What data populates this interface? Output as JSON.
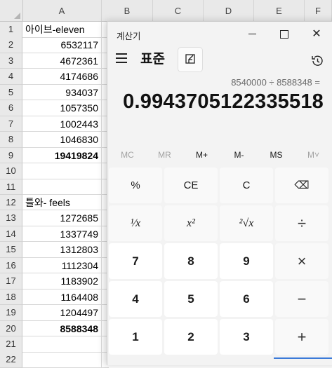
{
  "sheet": {
    "columns": [
      "A",
      "B",
      "C",
      "D",
      "E",
      "F"
    ],
    "rows": [
      {
        "num": "1",
        "a": "아이브-eleven",
        "type": "txt",
        "bold": false
      },
      {
        "num": "2",
        "a": "6532117",
        "type": "num",
        "bold": false
      },
      {
        "num": "3",
        "a": "4672361",
        "type": "num",
        "bold": false
      },
      {
        "num": "4",
        "a": "4174686",
        "type": "num",
        "bold": false
      },
      {
        "num": "5",
        "a": "934037",
        "type": "num",
        "bold": false
      },
      {
        "num": "6",
        "a": "1057350",
        "type": "num",
        "bold": false
      },
      {
        "num": "7",
        "a": "1002443",
        "type": "num",
        "bold": false
      },
      {
        "num": "8",
        "a": "1046830",
        "type": "num",
        "bold": false
      },
      {
        "num": "9",
        "a": "19419824",
        "type": "num",
        "bold": true
      },
      {
        "num": "10",
        "a": "",
        "type": "txt",
        "bold": false
      },
      {
        "num": "11",
        "a": "",
        "type": "txt",
        "bold": false
      },
      {
        "num": "12",
        "a": "틀와- feels",
        "type": "txt",
        "bold": false
      },
      {
        "num": "13",
        "a": "1272685",
        "type": "num",
        "bold": false
      },
      {
        "num": "14",
        "a": "1337749",
        "type": "num",
        "bold": false
      },
      {
        "num": "15",
        "a": "1312803",
        "type": "num",
        "bold": false
      },
      {
        "num": "16",
        "a": "1112304",
        "type": "num",
        "bold": false
      },
      {
        "num": "17",
        "a": "1183902",
        "type": "num",
        "bold": false
      },
      {
        "num": "18",
        "a": "1164408",
        "type": "num",
        "bold": false
      },
      {
        "num": "19",
        "a": "1204497",
        "type": "num",
        "bold": false
      },
      {
        "num": "20",
        "a": "8588348",
        "type": "num",
        "bold": true
      },
      {
        "num": "21",
        "a": "",
        "type": "txt",
        "bold": false
      },
      {
        "num": "22",
        "a": "",
        "type": "txt",
        "bold": false
      }
    ]
  },
  "calculator": {
    "title": "계산기",
    "mode": "표준",
    "expression": "8540000 ÷ 8588348 =",
    "result": "0.9943705122335518",
    "memory": [
      {
        "label": "MC",
        "enabled": false
      },
      {
        "label": "MR",
        "enabled": false
      },
      {
        "label": "M+",
        "enabled": true
      },
      {
        "label": "M-",
        "enabled": true
      },
      {
        "label": "MS",
        "enabled": true
      },
      {
        "label": "M˅",
        "enabled": false
      }
    ],
    "keys": [
      [
        {
          "label": "%",
          "kind": "op",
          "name": "percent-button"
        },
        {
          "label": "CE",
          "kind": "op",
          "name": "clear-entry-button"
        },
        {
          "label": "C",
          "kind": "op",
          "name": "clear-button"
        },
        {
          "label": "⌫",
          "kind": "op",
          "name": "backspace-button"
        }
      ],
      [
        {
          "label": "¹⁄x",
          "kind": "op italic",
          "name": "reciprocal-button"
        },
        {
          "label": "x²",
          "kind": "op italic",
          "name": "square-button"
        },
        {
          "label": "²√x",
          "kind": "op italic",
          "name": "square-root-button"
        },
        {
          "label": "÷",
          "kind": "op opsym",
          "name": "divide-button"
        }
      ],
      [
        {
          "label": "7",
          "kind": "dig",
          "name": "digit-7-button"
        },
        {
          "label": "8",
          "kind": "dig",
          "name": "digit-8-button"
        },
        {
          "label": "9",
          "kind": "dig",
          "name": "digit-9-button"
        },
        {
          "label": "×",
          "kind": "op opsym",
          "name": "multiply-button"
        }
      ],
      [
        {
          "label": "4",
          "kind": "dig",
          "name": "digit-4-button"
        },
        {
          "label": "5",
          "kind": "dig",
          "name": "digit-5-button"
        },
        {
          "label": "6",
          "kind": "dig",
          "name": "digit-6-button"
        },
        {
          "label": "−",
          "kind": "op opsym",
          "name": "subtract-button"
        }
      ],
      [
        {
          "label": "1",
          "kind": "dig",
          "name": "digit-1-button"
        },
        {
          "label": "2",
          "kind": "dig",
          "name": "digit-2-button"
        },
        {
          "label": "3",
          "kind": "dig",
          "name": "digit-3-button"
        },
        {
          "label": "+",
          "kind": "op opsym",
          "name": "add-button"
        }
      ]
    ],
    "accent_color": "#3b7ad9"
  }
}
